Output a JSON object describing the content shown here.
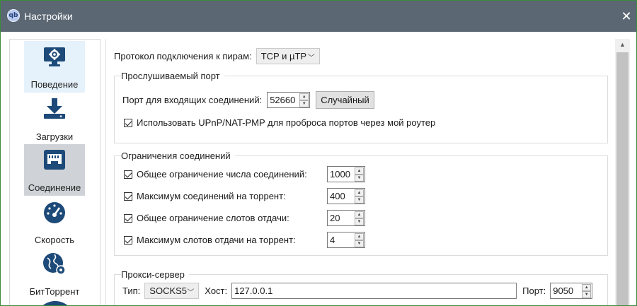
{
  "window": {
    "title": "Настройки",
    "app_icon": "qb"
  },
  "sidebar": {
    "items": [
      {
        "label": "Поведение",
        "icon": "monitor-gear-icon"
      },
      {
        "label": "Загрузки",
        "icon": "download-icon"
      },
      {
        "label": "Соединение",
        "icon": "network-port-icon"
      },
      {
        "label": "Скорость",
        "icon": "speedometer-icon"
      },
      {
        "label": "БитТоррент",
        "icon": "globe-gear-icon"
      }
    ]
  },
  "protocol": {
    "label": "Протокол подключения к пирам:",
    "value": "TCP и µTP"
  },
  "listening_port": {
    "title": "Прослушиваемый порт",
    "port_label": "Порт для входящих соединений:",
    "port_value": "52660",
    "random_button": "Случайный",
    "upnp_label": "Использовать UPnP/NAT-PMP для проброса портов через мой роутер",
    "upnp_checked": true
  },
  "connection_limits": {
    "title": "Ограничения соединений",
    "rows": [
      {
        "label": "Общее ограничение числа соединений:",
        "value": "1000",
        "checked": true
      },
      {
        "label": "Максимум соединений на торрент:",
        "value": "400",
        "checked": true
      },
      {
        "label": "Общее ограничение слотов отдачи:",
        "value": "20",
        "checked": true
      },
      {
        "label": "Максимум слотов отдачи на торрент:",
        "value": "4",
        "checked": true
      }
    ]
  },
  "proxy": {
    "title": "Прокси-сервер",
    "type_label": "Тип:",
    "type_value": "SOCKS5",
    "host_label": "Хост:",
    "host_value": "127.0.0.1",
    "port_label": "Порт:",
    "port_value": "9050"
  },
  "colors": {
    "titlebar": "#5b6773",
    "selected_item": "#cfd3d7",
    "hover_item": "#e5f1fb",
    "icon_blue": "#1d4a78"
  }
}
